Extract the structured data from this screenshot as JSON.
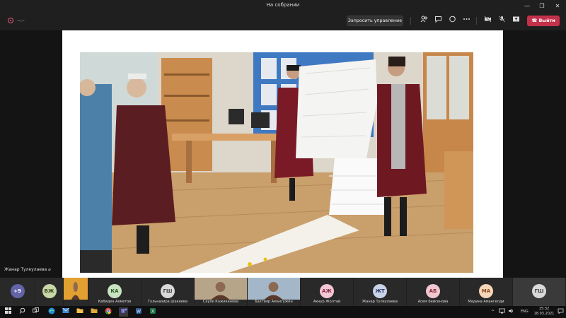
{
  "window": {
    "title": "На собрании",
    "minimize": "—",
    "maximize": "❐",
    "close": "✕"
  },
  "toolbar": {
    "timer": "--:--",
    "request_control_label": "Запросить управление",
    "leave_label": "Выйти",
    "icons": [
      "people-icon",
      "chat-icon",
      "reactions-icon",
      "more-icon",
      "camera-off-icon",
      "mic-off-icon",
      "share-icon"
    ]
  },
  "stage": {
    "speaker_name": "Жанар Тулеулаева"
  },
  "participants": [
    {
      "initials": "+9",
      "name": "",
      "color": "#6264a7",
      "text": "#ffffff",
      "type": "overflow"
    },
    {
      "initials": "ВЖ",
      "name": "",
      "color": "#c8d7a8",
      "text": "#3a4a1c"
    },
    {
      "initials": "",
      "name": "",
      "color": "#e2a030",
      "text": "#000",
      "type": "photo"
    },
    {
      "initials": "КА",
      "name": "Кабиден Ахметов",
      "color": "#c7e3c1",
      "text": "#2d5a24"
    },
    {
      "initials": "ГШ",
      "name": "Гульназира Шакеева",
      "color": "#d9d9d9",
      "text": "#444"
    },
    {
      "initials": "",
      "name": "Сауле Кажикенова",
      "color": "#b7a58a",
      "text": "#000",
      "type": "photo"
    },
    {
      "initials": "",
      "name": "Бахтияр Амангужин",
      "color": "#a4b7c8",
      "text": "#000",
      "type": "photo"
    },
    {
      "initials": "АЖ",
      "name": "Акнур Жолтай",
      "color": "#f3c7d4",
      "text": "#8a2a4a"
    },
    {
      "initials": "ЖТ",
      "name": "Жанар Тулеулаева",
      "color": "#c8d2e8",
      "text": "#2a3a6a"
    },
    {
      "initials": "АБ",
      "name": "Асем Бейсенова",
      "color": "#f0c7d0",
      "text": "#8a2a3a"
    },
    {
      "initials": "МА",
      "name": "Мадина Амангелди",
      "color": "#f5d6b8",
      "text": "#8a4a1a"
    },
    {
      "initials": "ГШ",
      "name": "",
      "color": "#d9d9d9",
      "text": "#444"
    }
  ],
  "taskbar": {
    "apps": [
      "windows-icon",
      "search-icon",
      "task-view-icon",
      "edge-icon",
      "mail-icon",
      "explorer-icon",
      "chrome-icon",
      "teams-icon",
      "word-icon",
      "excel-icon"
    ],
    "language": "ENG",
    "time": "15:32",
    "date": "18.03.2021"
  }
}
